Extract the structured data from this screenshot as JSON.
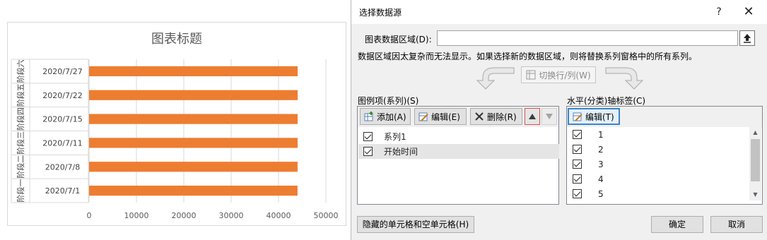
{
  "chart": {
    "title": "图表标题"
  },
  "chart_data": {
    "type": "bar",
    "orientation": "horizontal",
    "title": "图表标题",
    "categories": [
      {
        "group": "阶段一",
        "date": "2020/7/1"
      },
      {
        "group": "阶段二",
        "date": "2020/7/8"
      },
      {
        "group": "阶段三",
        "date": "2020/7/11"
      },
      {
        "group": "阶段四",
        "date": "2020/7/15"
      },
      {
        "group": "阶段五",
        "date": "2020/7/22"
      },
      {
        "group": "阶段六",
        "date": "2020/7/27"
      }
    ],
    "series": [
      {
        "values": [
          44013,
          44020,
          44023,
          44027,
          44034,
          44039
        ],
        "color": "#ED7D31"
      }
    ],
    "xticks": [
      "0",
      "10000",
      "20000",
      "30000",
      "40000",
      "50000"
    ],
    "xlim": [
      0,
      50000
    ],
    "grid": true,
    "legend": "none"
  },
  "dialog": {
    "title": "选择数据源",
    "help": "?",
    "close": "✕",
    "range_label": "图表数据区域(D):",
    "range_value": "",
    "message": "数据区域因太复杂而无法显示。如果选择新的数据区域，则将替换系列窗格中的所有系列。",
    "switch_label": "切换行/列(W)",
    "legend_panel": {
      "label": "图例项(系列)(S)",
      "add": "添加(A)",
      "edit": "编辑(E)",
      "remove": "删除(R)",
      "items": [
        "系列1",
        "开始时间"
      ]
    },
    "axis_panel": {
      "label": "水平(分类)轴标签(C)",
      "edit": "编辑(T)",
      "items": [
        "1",
        "2",
        "3",
        "4",
        "5"
      ]
    },
    "hidden_cells": "隐藏的单元格和空单元格(H)",
    "ok": "确定",
    "cancel": "取消"
  },
  "colors": {
    "bar": "#ED7D31",
    "selected_row": "#e5e5e5",
    "highlight_border": "#d9534f",
    "focus_border": "#3a86c8"
  }
}
